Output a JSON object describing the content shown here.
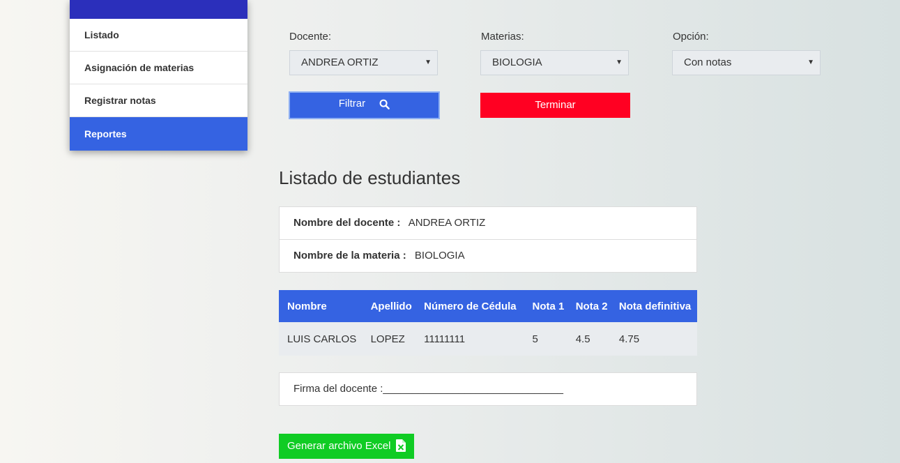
{
  "sidebar": {
    "items": [
      {
        "label": "Listado"
      },
      {
        "label": "Asignación de materias"
      },
      {
        "label": "Registrar notas"
      },
      {
        "label": "Reportes"
      }
    ]
  },
  "filters": {
    "docente": {
      "label": "Docente:",
      "value": "ANDREA ORTIZ"
    },
    "materias": {
      "label": "Materias:",
      "value": "BIOLOGIA"
    },
    "opcion": {
      "label": "Opción:",
      "value": "Con notas"
    },
    "filter_button": "Filtrar",
    "end_button": "Terminar"
  },
  "main": {
    "title": "Listado de estudiantes",
    "teacher_label": "Nombre del docente :",
    "teacher_value": "ANDREA ORTIZ",
    "subject_label": "Nombre de la materia :",
    "subject_value": "BIOLOGIA",
    "table": {
      "headers": [
        "Nombre",
        "Apellido",
        "Número de Cédula",
        "Nota 1",
        "Nota 2",
        "Nota definitiva"
      ],
      "rows": [
        [
          "LUIS CARLOS",
          "LOPEZ",
          "11111111",
          "5",
          "4.5",
          "4.75"
        ]
      ]
    },
    "signature": "Firma del docente :_______________________________",
    "excel_button": "Generar archivo Excel"
  },
  "colors": {
    "primary": "#3563e2",
    "danger": "#ff0022",
    "success": "#10cc24",
    "sidebar_header": "#2b2fbb"
  }
}
